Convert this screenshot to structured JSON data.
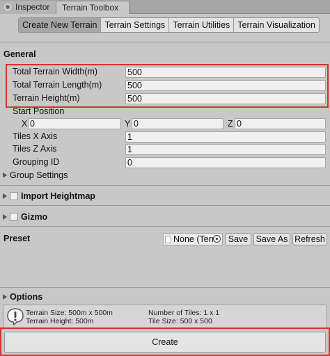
{
  "window_tabs": [
    {
      "label": "Inspector"
    },
    {
      "label": "Terrain Toolbox"
    }
  ],
  "toolbar": {
    "tabs": [
      "Create New Terrain",
      "Terrain Settings",
      "Terrain Utilities",
      "Terrain Visualization"
    ],
    "selected": "Create New Terrain"
  },
  "general": {
    "title": "General",
    "width_label": "Total Terrain Width(m)",
    "width_value": "500",
    "length_label": "Total Terrain Length(m)",
    "length_value": "500",
    "height_label": "Terrain Height(m)",
    "height_value": "500",
    "start_position_label": "Start Position",
    "x_label": "X",
    "x_value": "0",
    "y_label": "Y",
    "y_value": "0",
    "z_label": "Z",
    "z_value": "0",
    "tiles_x_label": "Tiles X Axis",
    "tiles_x_value": "1",
    "tiles_z_label": "Tiles Z Axis",
    "tiles_z_value": "1",
    "grouping_label": "Grouping ID",
    "grouping_value": "0",
    "group_settings_label": "Group Settings"
  },
  "import_heightmap": {
    "label": "Import Heightmap"
  },
  "gizmo": {
    "label": "Gizmo"
  },
  "preset": {
    "title": "Preset",
    "object_value": "None (Terr",
    "save_label": "Save",
    "save_as_label": "Save As",
    "refresh_label": "Refresh"
  },
  "options": {
    "label": "Options",
    "terrain_size": "Terrain Size: 500m x 500m",
    "terrain_height": "Terrain Height: 500m",
    "num_tiles": "Number of Tiles: 1 x 1",
    "tile_size": "Tile Size: 500 x 500"
  },
  "create_label": "Create",
  "colors": {
    "highlight": "#d9322a",
    "background": "#c8c8c8"
  }
}
